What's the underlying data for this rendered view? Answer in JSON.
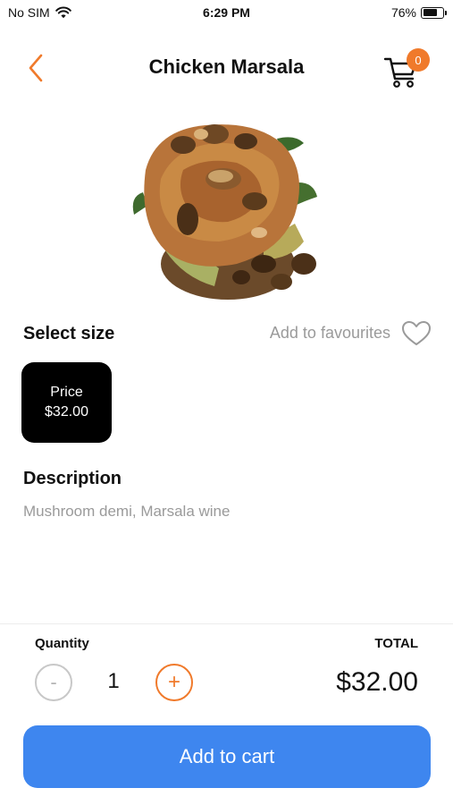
{
  "status_bar": {
    "carrier": "No SIM",
    "time": "6:29 PM",
    "battery_percent": "76%",
    "battery_level": 0.76,
    "wifi_icon": "wifi-icon"
  },
  "nav": {
    "title": "Chicken Marsala",
    "back_icon": "chevron-left-icon",
    "cart_icon": "shopping-cart-icon",
    "cart_count": "0"
  },
  "size": {
    "label": "Select size",
    "favourites_label": "Add to favourites",
    "favourites_icon": "heart-outline-icon",
    "options": [
      {
        "label": "Price",
        "price": "$32.00",
        "selected": true
      }
    ]
  },
  "description": {
    "title": "Description",
    "text": "Mushroom demi, Marsala wine"
  },
  "order": {
    "quantity_label": "Quantity",
    "total_label": "TOTAL",
    "minus_label": "-",
    "quantity": "1",
    "plus_label": "+",
    "total": "$32.00",
    "add_to_cart_label": "Add to cart"
  },
  "colors": {
    "accent": "#f07a2b",
    "primary_button": "#3e86ef",
    "muted_text": "#9a9a9a"
  }
}
